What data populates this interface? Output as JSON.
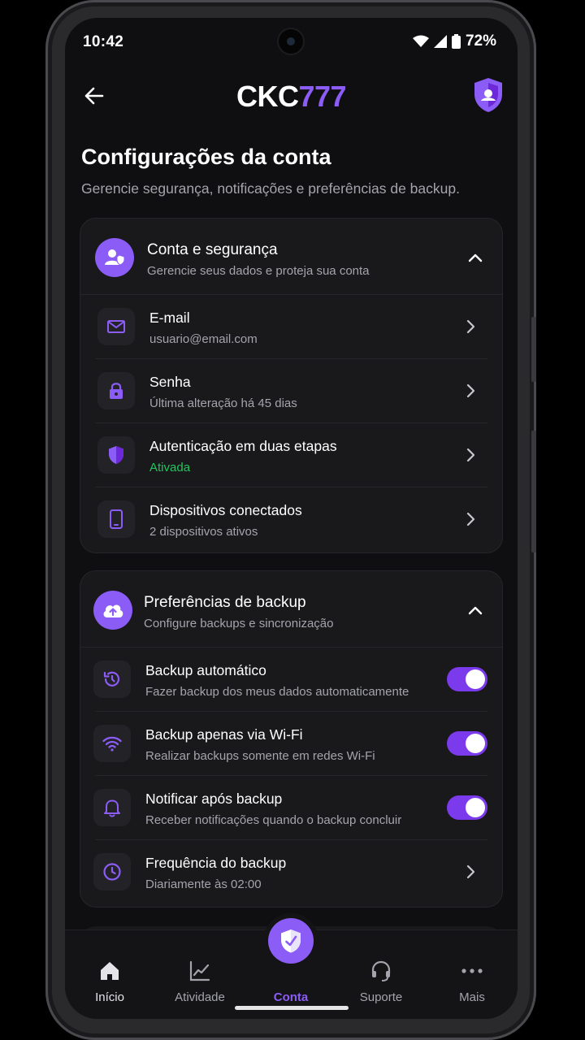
{
  "status": {
    "time": "10:42",
    "battery": "72%"
  },
  "header": {
    "logo_main": "CKC",
    "logo_accent": "777"
  },
  "page": {
    "title": "Configurações da conta",
    "subtitle": "Gerencie segurança, notificações e preferências de backup."
  },
  "account_card": {
    "title": "Conta e segurança",
    "subtitle": "Gerencie seus dados e proteja sua conta",
    "items": [
      {
        "title": "E-mail",
        "subtitle": "usuario@email.com",
        "icon": "mail-icon"
      },
      {
        "title": "Senha",
        "subtitle": "Última alteração há 45 dias",
        "icon": "lock-icon"
      },
      {
        "title": "Autenticação em duas etapas",
        "subtitle": "Ativada",
        "icon": "shield-icon"
      },
      {
        "title": "Dispositivos conectados",
        "subtitle": "2 dispositivos ativos",
        "icon": "smartphone-icon"
      }
    ]
  },
  "backup_card": {
    "title": "Preferências de backup",
    "subtitle": "Configure backups e sincronização",
    "items": [
      {
        "title": "Backup automático",
        "subtitle": "Fazer backup dos meus dados automaticamente",
        "icon": "history-icon",
        "enabled": true
      },
      {
        "title": "Backup apenas via Wi-Fi",
        "subtitle": "Realizar backups somente em redes Wi-Fi",
        "icon": "wifi-icon",
        "enabled": true
      },
      {
        "title": "Notificar após backup",
        "subtitle": "Receber notificações quando o backup concluir",
        "icon": "bell-icon",
        "enabled": true
      },
      {
        "title": "Frequência do backup",
        "subtitle": "Diariamente às 02:00",
        "icon": "clock-icon"
      }
    ]
  },
  "nav": {
    "items": [
      {
        "label": "Início",
        "icon": "home-icon"
      },
      {
        "label": "Atividade",
        "icon": "chart-icon"
      },
      {
        "label": "Conta",
        "icon": "shield-icon",
        "active": true
      },
      {
        "label": "Suporte",
        "icon": "headset-icon"
      },
      {
        "label": "Mais",
        "icon": "more-icon"
      }
    ]
  },
  "colors": {
    "accent": "#8b5cf6",
    "success": "#22c55e",
    "background": "#0f0f11",
    "card": "#19191c"
  }
}
